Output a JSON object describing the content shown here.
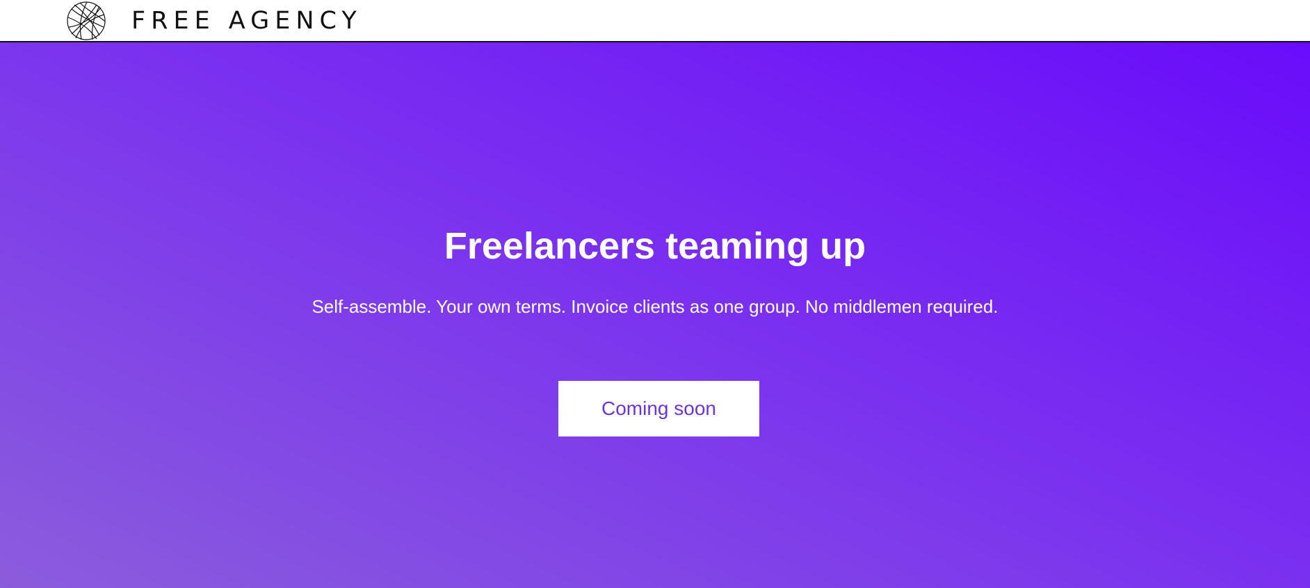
{
  "header": {
    "brand_name": "FREE AGENCY",
    "logo_icon": "globe-logo-icon"
  },
  "hero": {
    "title": "Freelancers teaming up",
    "subtitle": "Self-assemble. Your own terms. Invoice clients as one group. No middlemen required.",
    "cta_label": "Coming soon"
  },
  "colors": {
    "gradient_start": "#6a0cfa",
    "gradient_mid": "#7a2ff0",
    "gradient_end": "#8a5ddc",
    "button_text": "#6b35d6",
    "header_background": "#ffffff"
  }
}
